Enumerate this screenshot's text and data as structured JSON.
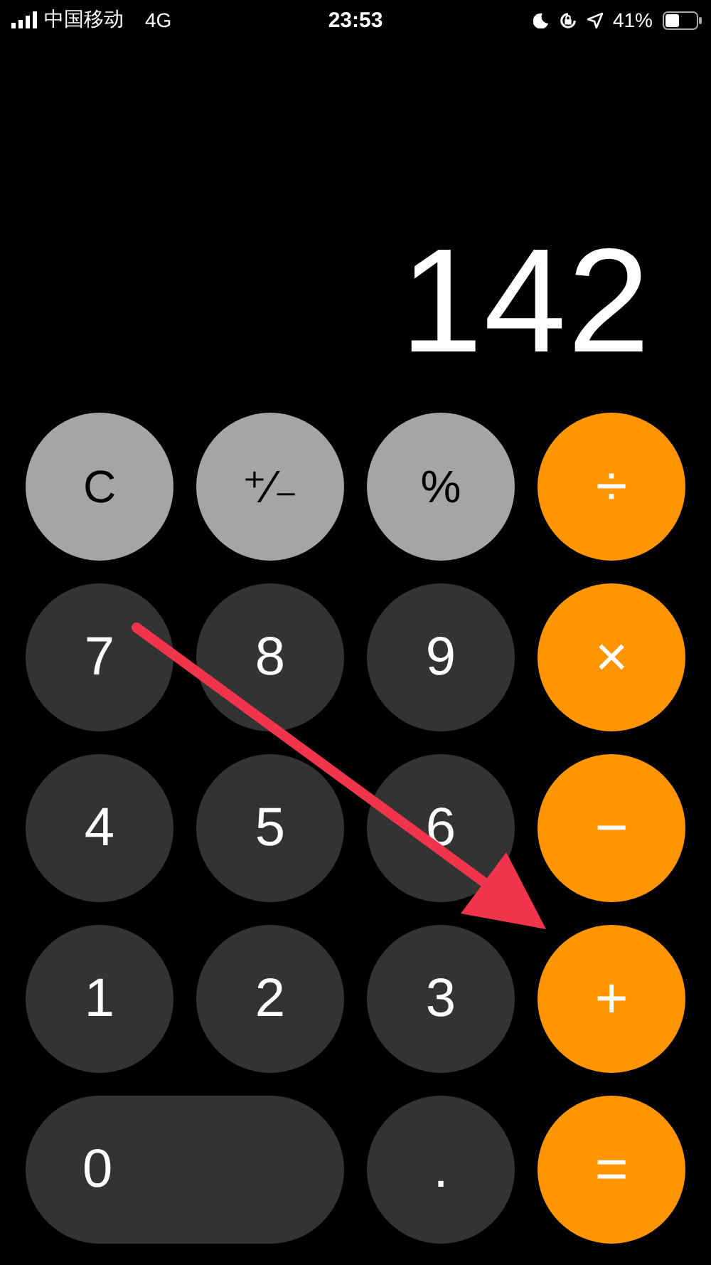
{
  "status_bar": {
    "carrier": "中国移动",
    "network": "4G",
    "time": "23:53",
    "battery": "41%"
  },
  "display": {
    "value": "142"
  },
  "keys": [
    {
      "label": "C",
      "kind": "function",
      "wide": false
    },
    {
      "label": "⁺∕₋",
      "kind": "function",
      "wide": false
    },
    {
      "label": "%",
      "kind": "function",
      "wide": false
    },
    {
      "label": "÷",
      "kind": "operator",
      "wide": false
    },
    {
      "label": "7",
      "kind": "digit",
      "wide": false
    },
    {
      "label": "8",
      "kind": "digit",
      "wide": false
    },
    {
      "label": "9",
      "kind": "digit",
      "wide": false
    },
    {
      "label": "×",
      "kind": "operator",
      "wide": false
    },
    {
      "label": "4",
      "kind": "digit",
      "wide": false
    },
    {
      "label": "5",
      "kind": "digit",
      "wide": false
    },
    {
      "label": "6",
      "kind": "digit",
      "wide": false
    },
    {
      "label": "−",
      "kind": "operator",
      "wide": false
    },
    {
      "label": "1",
      "kind": "digit",
      "wide": false
    },
    {
      "label": "2",
      "kind": "digit",
      "wide": false
    },
    {
      "label": "3",
      "kind": "digit",
      "wide": false
    },
    {
      "label": "+",
      "kind": "operator",
      "wide": false
    },
    {
      "label": "0",
      "kind": "digit",
      "wide": true
    },
    {
      "label": ".",
      "kind": "digit",
      "wide": false
    },
    {
      "label": "=",
      "kind": "operator",
      "wide": false
    }
  ]
}
